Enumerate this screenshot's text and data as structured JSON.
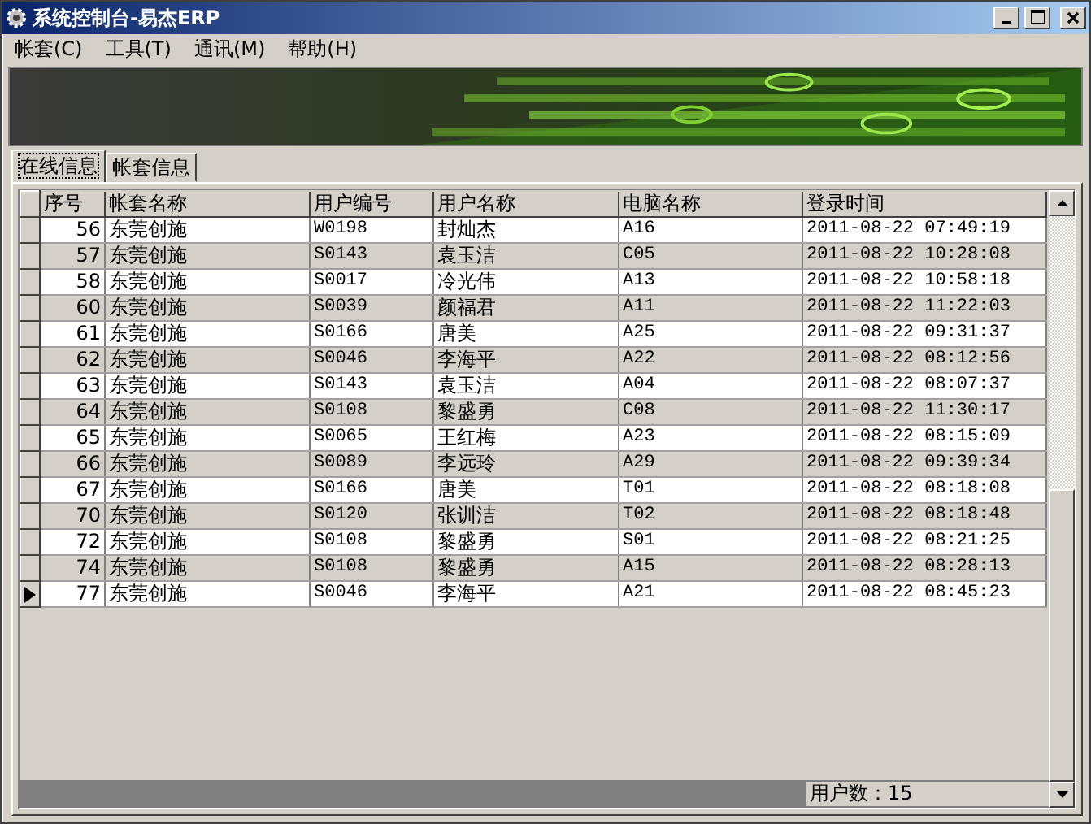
{
  "window": {
    "title": "系统控制台-易杰ERP"
  },
  "menu": [
    "帐套(C)",
    "工具(T)",
    "通讯(M)",
    "帮助(H)"
  ],
  "tabs": [
    {
      "label": "在线信息",
      "selected": true
    },
    {
      "label": "帐套信息",
      "selected": false
    }
  ],
  "table": {
    "columns": [
      "序号",
      "帐套名称",
      "用户编号",
      "用户名称",
      "电脑名称",
      "登录时间"
    ],
    "rows": [
      {
        "cells": [
          "56",
          "东莞创施",
          "W0198",
          "封灿杰",
          "A16",
          "2011-08-22 07:49:19"
        ],
        "selected": false
      },
      {
        "cells": [
          "57",
          "东莞创施",
          "S0143",
          "袁玉洁",
          "C05",
          "2011-08-22 10:28:08"
        ],
        "selected": false
      },
      {
        "cells": [
          "58",
          "东莞创施",
          "S0017",
          "冷光伟",
          "A13",
          "2011-08-22 10:58:18"
        ],
        "selected": false
      },
      {
        "cells": [
          "60",
          "东莞创施",
          "S0039",
          "颜福君",
          "A11",
          "2011-08-22 11:22:03"
        ],
        "selected": false
      },
      {
        "cells": [
          "61",
          "东莞创施",
          "S0166",
          "唐美",
          "A25",
          "2011-08-22 09:31:37"
        ],
        "selected": false
      },
      {
        "cells": [
          "62",
          "东莞创施",
          "S0046",
          "李海平",
          "A22",
          "2011-08-22 08:12:56"
        ],
        "selected": false
      },
      {
        "cells": [
          "63",
          "东莞创施",
          "S0143",
          "袁玉洁",
          "A04",
          "2011-08-22 08:07:37"
        ],
        "selected": false
      },
      {
        "cells": [
          "64",
          "东莞创施",
          "S0108",
          "黎盛勇",
          "C08",
          "2011-08-22 11:30:17"
        ],
        "selected": false
      },
      {
        "cells": [
          "65",
          "东莞创施",
          "S0065",
          "王红梅",
          "A23",
          "2011-08-22 08:15:09"
        ],
        "selected": false
      },
      {
        "cells": [
          "66",
          "东莞创施",
          "S0089",
          "李远玲",
          "A29",
          "2011-08-22 09:39:34"
        ],
        "selected": false
      },
      {
        "cells": [
          "67",
          "东莞创施",
          "S0166",
          "唐美",
          "T01",
          "2011-08-22 08:18:08"
        ],
        "selected": false
      },
      {
        "cells": [
          "70",
          "东莞创施",
          "S0120",
          "张训洁",
          "T02",
          "2011-08-22 08:18:48"
        ],
        "selected": false
      },
      {
        "cells": [
          "72",
          "东莞创施",
          "S0108",
          "黎盛勇",
          "S01",
          "2011-08-22 08:21:25"
        ],
        "selected": false
      },
      {
        "cells": [
          "74",
          "东莞创施",
          "S0108",
          "黎盛勇",
          "A15",
          "2011-08-22 08:28:13"
        ],
        "selected": false
      },
      {
        "cells": [
          "77",
          "东莞创施",
          "S0046",
          "李海平",
          "A21",
          "2011-08-22 08:45:23"
        ],
        "selected": true
      }
    ]
  },
  "footer": {
    "user_count": "用户数：15"
  }
}
